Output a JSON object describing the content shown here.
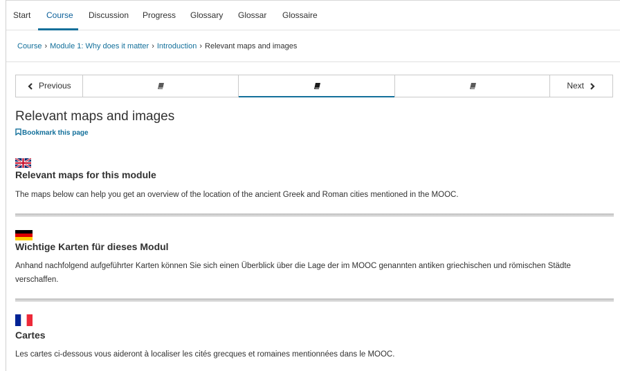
{
  "tabs": [
    {
      "label": "Start",
      "active": false
    },
    {
      "label": "Course",
      "active": true
    },
    {
      "label": "Discussion",
      "active": false
    },
    {
      "label": "Progress",
      "active": false
    },
    {
      "label": "Glossary",
      "active": false
    },
    {
      "label": "Glossar",
      "active": false
    },
    {
      "label": "Glossaire",
      "active": false
    }
  ],
  "breadcrumb": {
    "items": [
      "Course",
      "Module 1: Why does it matter",
      "Introduction"
    ],
    "current": "Relevant maps and images",
    "separator": "›"
  },
  "sequence_nav": {
    "previous_label": "Previous",
    "next_label": "Next",
    "units": [
      {
        "icon": "book-icon",
        "active": false
      },
      {
        "icon": "book-icon",
        "active": true
      },
      {
        "icon": "book-icon",
        "active": false
      }
    ]
  },
  "page": {
    "title": "Relevant maps and images",
    "bookmark_label": "Bookmark this page"
  },
  "sections": [
    {
      "flag": "uk-flag-icon",
      "title": "Relevant maps for this module",
      "text": "The maps below can help you get an overview of the location of the ancient Greek and Roman cities mentioned in the MOOC."
    },
    {
      "flag": "germany-flag-icon",
      "title": "Wichtige Karten für dieses Modul",
      "text": "Anhand nachfolgend aufgeführter Karten können Sie sich einen Überblick über die Lage der im MOOC genannten antiken griechischen und römischen Städte verschaffen."
    },
    {
      "flag": "france-flag-icon",
      "title": "Cartes",
      "text": "Les cartes ci-dessous vous aideront à localiser les cités grecques et romaines mentionnées dans le MOOC."
    }
  ],
  "colors": {
    "accent": "#126f9a",
    "text": "#313131",
    "border": "#c9c9c9"
  }
}
